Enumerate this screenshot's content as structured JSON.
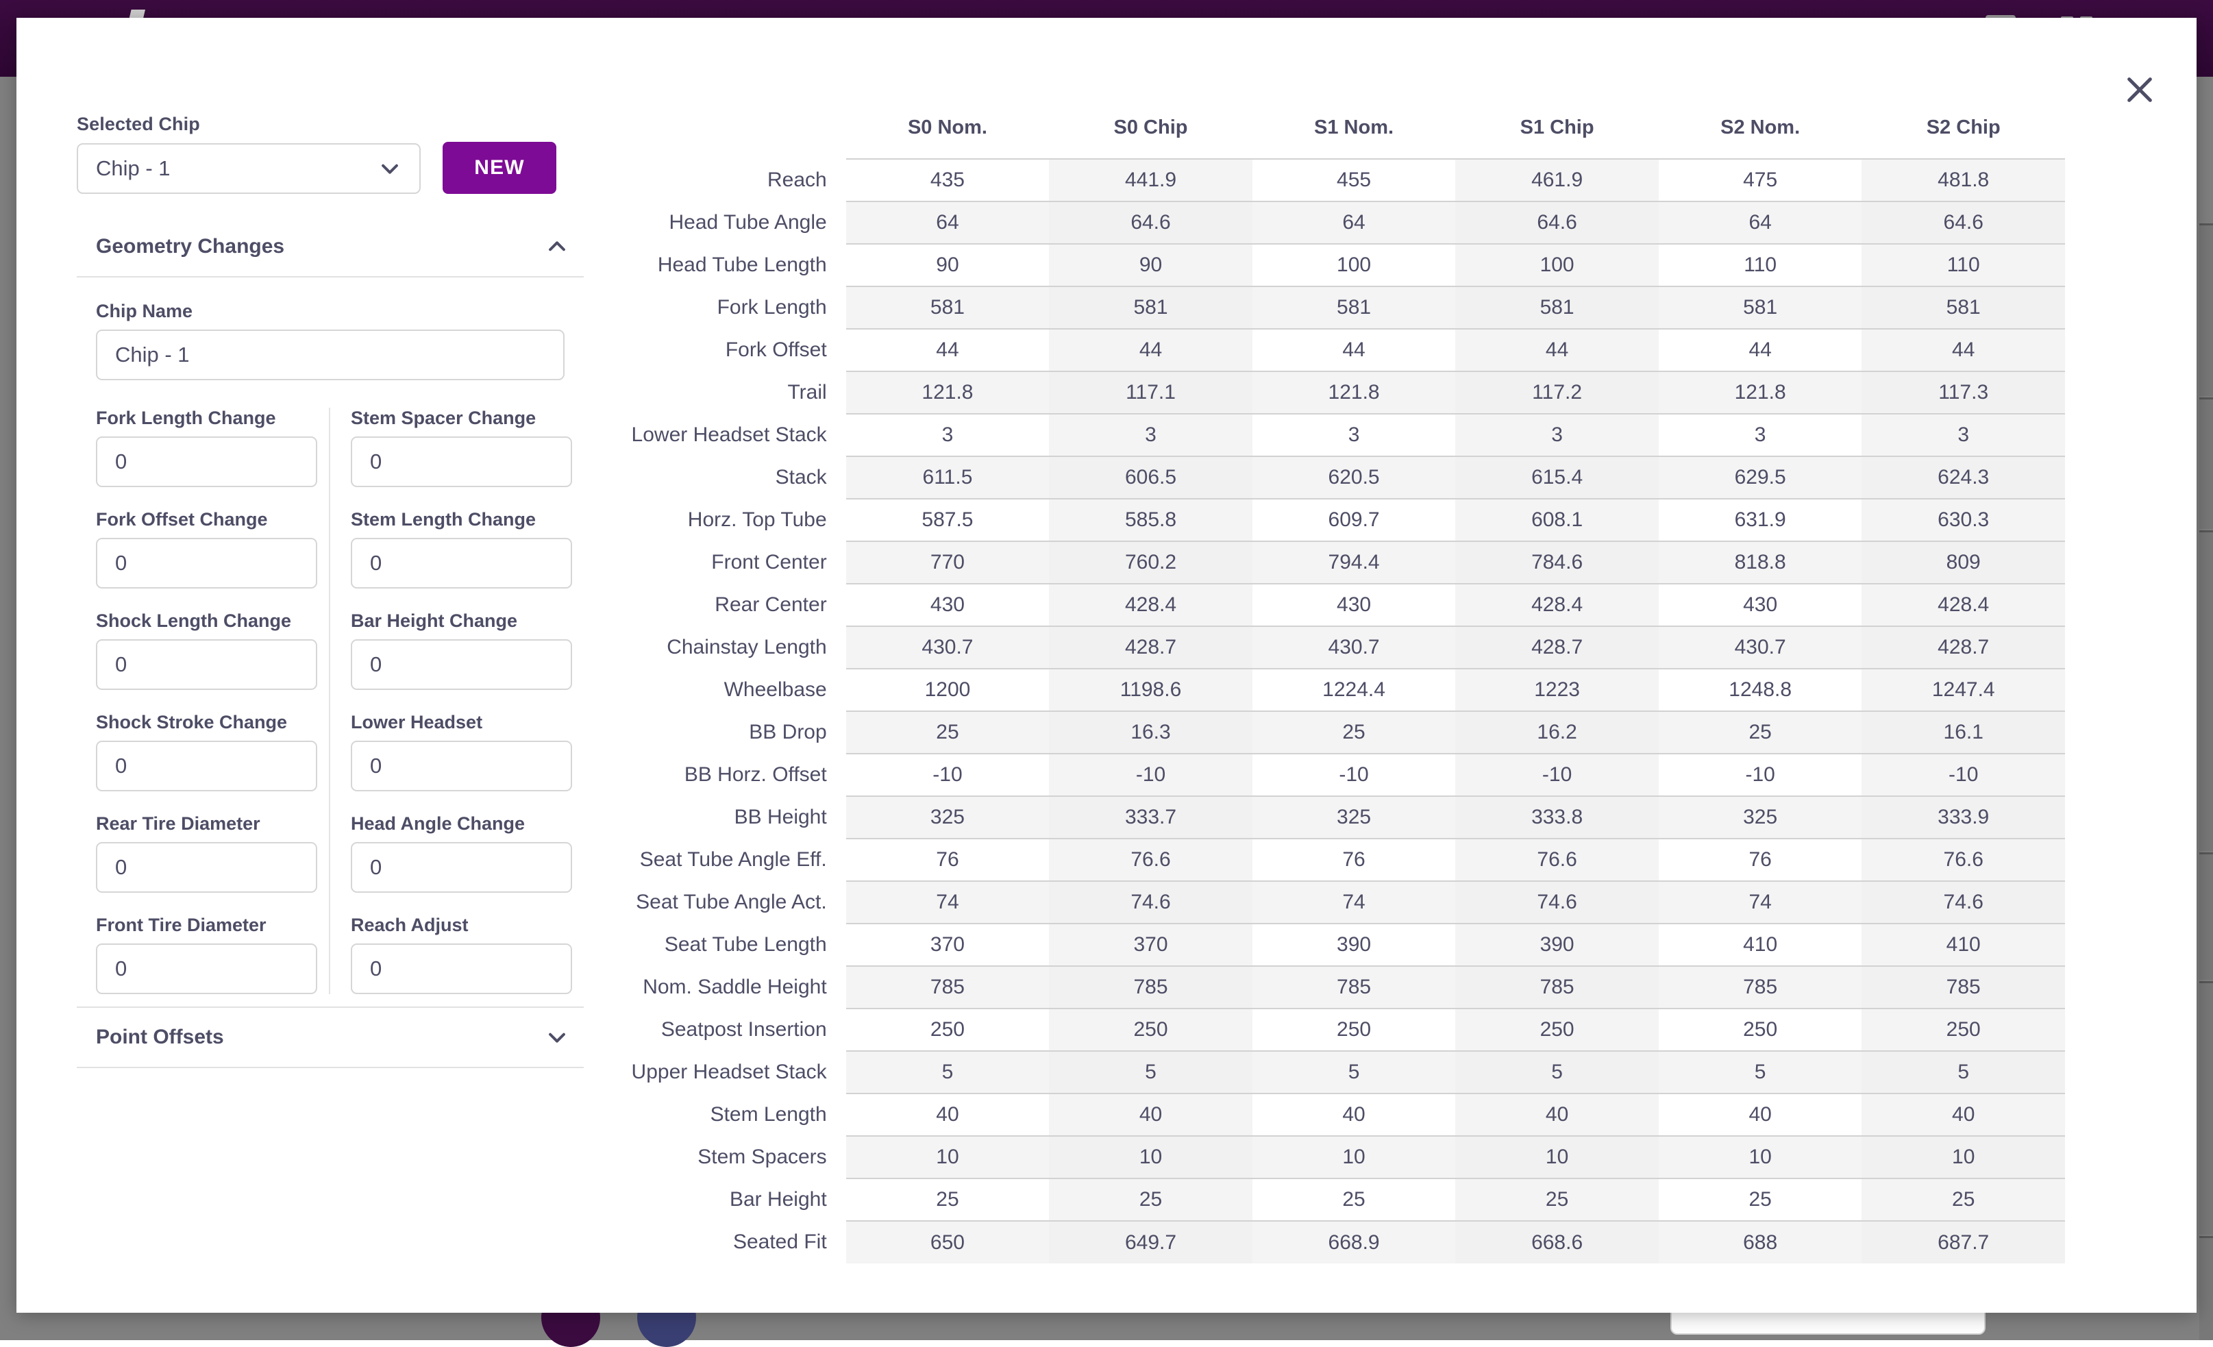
{
  "modal": {
    "close_icon": "close-icon"
  },
  "left_panel": {
    "selected_chip_label": "Selected Chip",
    "selected_chip_value": "Chip - 1",
    "new_button_label": "NEW",
    "geometry_section_title": "Geometry Changes",
    "geometry_section_state": "expanded",
    "chip_name_label": "Chip Name",
    "chip_name_value": "Chip - 1",
    "point_offsets_title": "Point Offsets",
    "point_offsets_state": "collapsed",
    "fields_left": [
      {
        "label": "Fork Length Change",
        "value": "0"
      },
      {
        "label": "Fork Offset Change",
        "value": "0"
      },
      {
        "label": "Shock Length Change",
        "value": "0"
      },
      {
        "label": "Shock Stroke Change",
        "value": "0"
      },
      {
        "label": "Rear Tire Diameter",
        "value": "0"
      },
      {
        "label": "Front Tire Diameter",
        "value": "0"
      }
    ],
    "fields_right": [
      {
        "label": "Stem Spacer Change",
        "value": "0"
      },
      {
        "label": "Stem Length Change",
        "value": "0"
      },
      {
        "label": "Bar Height Change",
        "value": "0"
      },
      {
        "label": "Lower Headset",
        "value": "0"
      },
      {
        "label": "Head Angle Change",
        "value": "0"
      },
      {
        "label": "Reach Adjust",
        "value": "0"
      }
    ]
  },
  "colors": {
    "accent_purple": "#7d0b95",
    "text_navy": "#4d4d66",
    "stripe_gray": "#f4f4f4",
    "topbar_purple": "#3b0b40"
  },
  "chart_data": {
    "type": "table",
    "title": "",
    "columns": [
      "",
      "S0 Nom.",
      "S0 Chip",
      "S1 Nom.",
      "S1 Chip",
      "S2 Nom.",
      "S2 Chip"
    ],
    "chip_column_indices": [
      2,
      4,
      6
    ],
    "rows": [
      {
        "label": "Reach",
        "values": [
          "435",
          "441.9",
          "455",
          "461.9",
          "475",
          "481.8"
        ]
      },
      {
        "label": "Head Tube Angle",
        "values": [
          "64",
          "64.6",
          "64",
          "64.6",
          "64",
          "64.6"
        ]
      },
      {
        "label": "Head Tube Length",
        "values": [
          "90",
          "90",
          "100",
          "100",
          "110",
          "110"
        ]
      },
      {
        "label": "Fork Length",
        "values": [
          "581",
          "581",
          "581",
          "581",
          "581",
          "581"
        ]
      },
      {
        "label": "Fork Offset",
        "values": [
          "44",
          "44",
          "44",
          "44",
          "44",
          "44"
        ]
      },
      {
        "label": "Trail",
        "values": [
          "121.8",
          "117.1",
          "121.8",
          "117.2",
          "121.8",
          "117.3"
        ]
      },
      {
        "label": "Lower Headset Stack",
        "values": [
          "3",
          "3",
          "3",
          "3",
          "3",
          "3"
        ]
      },
      {
        "label": "Stack",
        "values": [
          "611.5",
          "606.5",
          "620.5",
          "615.4",
          "629.5",
          "624.3"
        ]
      },
      {
        "label": "Horz. Top Tube",
        "values": [
          "587.5",
          "585.8",
          "609.7",
          "608.1",
          "631.9",
          "630.3"
        ]
      },
      {
        "label": "Front Center",
        "values": [
          "770",
          "760.2",
          "794.4",
          "784.6",
          "818.8",
          "809"
        ]
      },
      {
        "label": "Rear Center",
        "values": [
          "430",
          "428.4",
          "430",
          "428.4",
          "430",
          "428.4"
        ]
      },
      {
        "label": "Chainstay Length",
        "values": [
          "430.7",
          "428.7",
          "430.7",
          "428.7",
          "430.7",
          "428.7"
        ]
      },
      {
        "label": "Wheelbase",
        "values": [
          "1200",
          "1198.6",
          "1224.4",
          "1223",
          "1248.8",
          "1247.4"
        ]
      },
      {
        "label": "BB Drop",
        "values": [
          "25",
          "16.3",
          "25",
          "16.2",
          "25",
          "16.1"
        ]
      },
      {
        "label": "BB Horz. Offset",
        "values": [
          "-10",
          "-10",
          "-10",
          "-10",
          "-10",
          "-10"
        ]
      },
      {
        "label": "BB Height",
        "values": [
          "325",
          "333.7",
          "325",
          "333.8",
          "325",
          "333.9"
        ]
      },
      {
        "label": "Seat Tube Angle Eff.",
        "values": [
          "76",
          "76.6",
          "76",
          "76.6",
          "76",
          "76.6"
        ]
      },
      {
        "label": "Seat Tube Angle Act.",
        "values": [
          "74",
          "74.6",
          "74",
          "74.6",
          "74",
          "74.6"
        ]
      },
      {
        "label": "Seat Tube Length",
        "values": [
          "370",
          "370",
          "390",
          "390",
          "410",
          "410"
        ]
      },
      {
        "label": "Nom. Saddle Height",
        "values": [
          "785",
          "785",
          "785",
          "785",
          "785",
          "785"
        ]
      },
      {
        "label": "Seatpost Insertion",
        "values": [
          "250",
          "250",
          "250",
          "250",
          "250",
          "250"
        ]
      },
      {
        "label": "Upper Headset Stack",
        "values": [
          "5",
          "5",
          "5",
          "5",
          "5",
          "5"
        ]
      },
      {
        "label": "Stem Length",
        "values": [
          "40",
          "40",
          "40",
          "40",
          "40",
          "40"
        ]
      },
      {
        "label": "Stem Spacers",
        "values": [
          "10",
          "10",
          "10",
          "10",
          "10",
          "10"
        ]
      },
      {
        "label": "Bar Height",
        "values": [
          "25",
          "25",
          "25",
          "25",
          "25",
          "25"
        ]
      },
      {
        "label": "Seated Fit",
        "values": [
          "650",
          "649.7",
          "668.9",
          "668.6",
          "688",
          "687.7"
        ]
      }
    ]
  }
}
